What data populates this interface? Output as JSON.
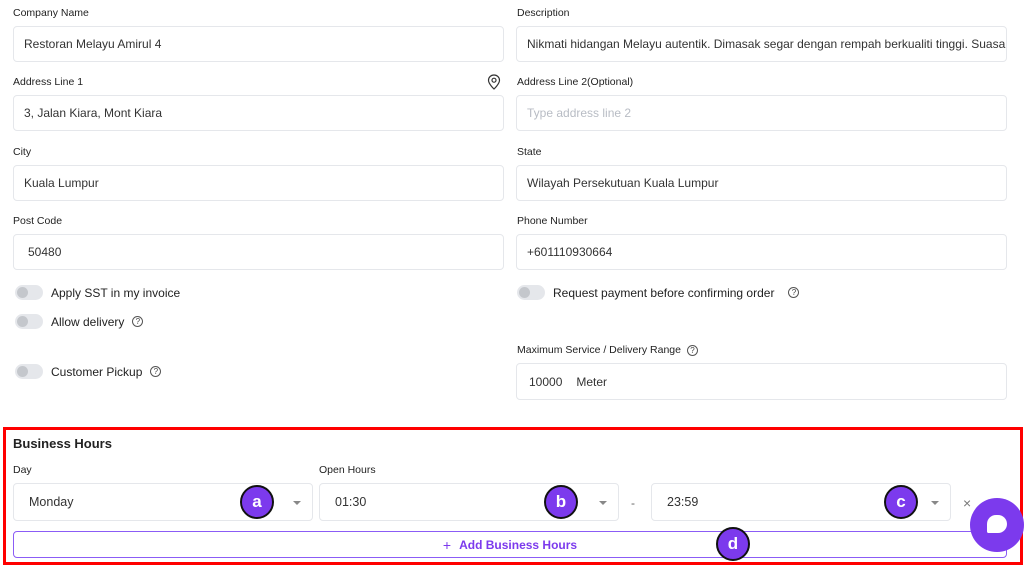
{
  "company": {
    "label": "Company Name",
    "value": "Restoran Melayu Amirul 4"
  },
  "description": {
    "label": "Description",
    "value": "Nikmati hidangan Melayu autentik. Dimasak segar dengan rempah berkualiti tinggi. Suasa"
  },
  "address1": {
    "label": "Address Line 1",
    "value": "3, Jalan Kiara, Mont Kiara"
  },
  "address2": {
    "label": "Address Line 2(Optional)",
    "placeholder": "Type address line 2"
  },
  "city": {
    "label": "City",
    "value": "Kuala Lumpur"
  },
  "state": {
    "label": "State",
    "value": "Wilayah Persekutuan Kuala Lumpur"
  },
  "postcode": {
    "label": "Post Code",
    "value": "50480"
  },
  "phone": {
    "label": "Phone Number",
    "value": "+601110930664"
  },
  "toggles": {
    "sst": "Apply SST in my invoice",
    "request_payment": "Request payment before confirming order",
    "delivery": "Allow delivery",
    "pickup": "Customer Pickup"
  },
  "range": {
    "label": "Maximum Service / Delivery Range",
    "value": "10000",
    "unit": "Meter"
  },
  "business_hours": {
    "title": "Business Hours",
    "day_label": "Day",
    "open_label": "Open Hours",
    "day": "Monday",
    "open_from": "01:30",
    "dash": "-",
    "open_to": "23:59",
    "remove": "×",
    "add_label": "Add Business Hours",
    "add_plus": "+"
  },
  "badges": {
    "a": "a",
    "b": "b",
    "c": "c",
    "d": "d"
  },
  "help_glyph": "?",
  "colors": {
    "accent": "#7c3aed",
    "highlight": "#ff0000"
  }
}
